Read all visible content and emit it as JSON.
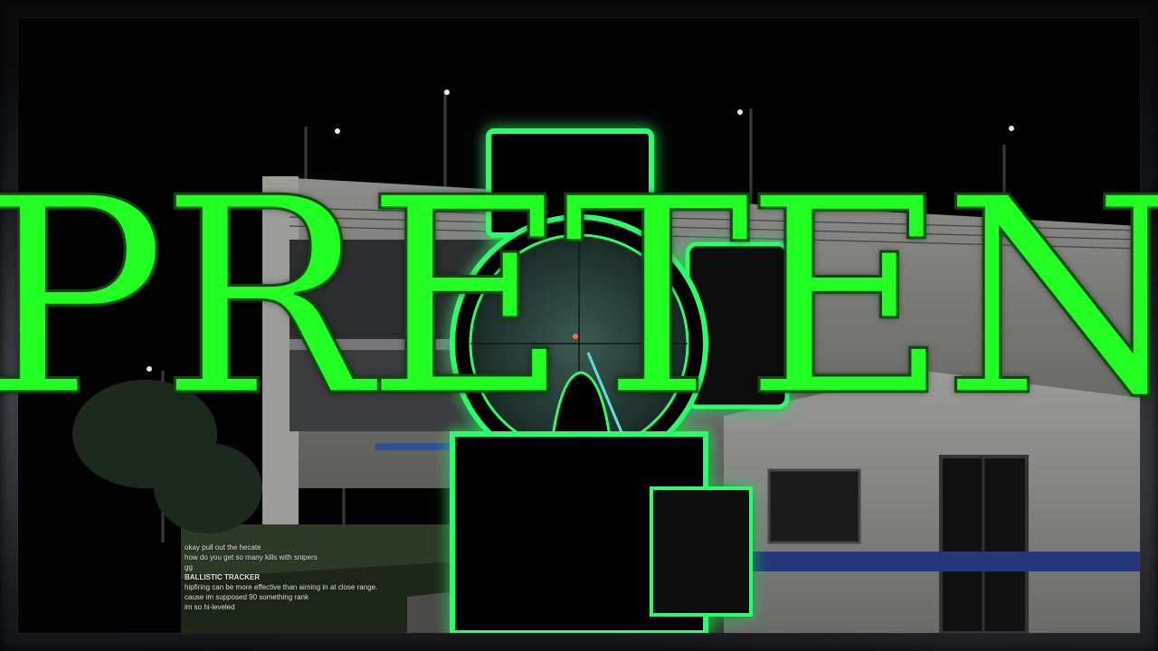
{
  "thumbnail": {
    "title": "PRETEND"
  },
  "chat": {
    "lines": [
      {
        "name": "",
        "text": "okay pull out the hecate"
      },
      {
        "name": "",
        "text": "how do you get so many kills with snipers"
      },
      {
        "name": "",
        "text": "gg"
      },
      {
        "name": "",
        "text": "BALLISTIC TRACKER",
        "emphasis": true
      },
      {
        "name": "",
        "text": "hipfiring can be more effective than aiming in at close range."
      },
      {
        "name": "",
        "text": "cause im supposed 90 something rank"
      },
      {
        "name": "",
        "text": "im so hi-leveled"
      }
    ]
  },
  "colors": {
    "title_green": "#22ff22",
    "scope_glow": "#2bff6a",
    "scope_body": "#050505"
  },
  "icons": {
    "scope": "rifle-scope-icon"
  }
}
